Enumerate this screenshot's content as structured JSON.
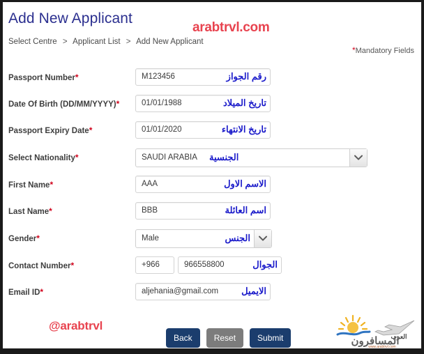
{
  "header": {
    "title": "Add New Applicant",
    "breadcrumb": [
      "Select Centre",
      "Applicant List",
      "Add New Applicant"
    ],
    "separator": ">",
    "mandatory_note": "Mandatory Fields",
    "mandatory_star": "*"
  },
  "watermarks": {
    "top": "arabtrvl.com",
    "bottom": "@arabtrvl",
    "logo_arabic_line1": "العرب",
    "logo_arabic_line2": "المسافرون",
    "logo_url": "www.arabtrvl.com"
  },
  "form": {
    "required_star": "*",
    "fields": [
      {
        "label": "Passport Number",
        "required": true,
        "type": "text",
        "value": "M123456",
        "placeholder": "",
        "arabic": "رقم الجواز",
        "name": "passport-number"
      },
      {
        "label": "Date Of Birth (DD/MM/YYYY)",
        "required": true,
        "type": "text",
        "value": "01/01/1988",
        "placeholder": "",
        "arabic": "تاريخ الميلاد",
        "name": "date-of-birth"
      },
      {
        "label": "Passport Expiry Date",
        "required": true,
        "type": "text",
        "value": "01/01/2020",
        "placeholder": "",
        "arabic": "تاريخ الانتهاء",
        "name": "passport-expiry-date"
      },
      {
        "label": "Select Nationality",
        "required": true,
        "type": "select-wide",
        "value": "SAUDI ARABIA",
        "arabic": "الجنسية",
        "name": "select-nationality"
      },
      {
        "label": "First Name",
        "required": true,
        "type": "text",
        "value": "AAA",
        "placeholder": "",
        "arabic": "الاسم الاول",
        "name": "first-name"
      },
      {
        "label": "Last Name",
        "required": true,
        "type": "text",
        "value": "BBB",
        "placeholder": "",
        "arabic": "اسم العائلة",
        "name": "last-name"
      },
      {
        "label": "Gender",
        "required": true,
        "type": "select-narrow",
        "value": "Male",
        "arabic": "الجنس",
        "name": "gender"
      },
      {
        "label": "Contact Number",
        "required": true,
        "type": "phone",
        "country_code": "+966",
        "value": "966558800",
        "placeholder": "",
        "arabic": "الجوال",
        "name": "contact-number"
      },
      {
        "label": "Email ID",
        "required": true,
        "type": "text",
        "value": "aljehania@gmail.com",
        "placeholder": "",
        "arabic": "الايميل",
        "name": "email-id"
      }
    ]
  },
  "buttons": {
    "back": "Back",
    "reset": "Reset",
    "submit": "Submit"
  },
  "colors": {
    "title": "#2b2f8f",
    "accent_primary": "#1b3d6d",
    "accent_secondary": "#7c7c7c",
    "required": "#d0021b",
    "arabic_annotation": "#1a1aca",
    "watermark": "#e8434f"
  }
}
